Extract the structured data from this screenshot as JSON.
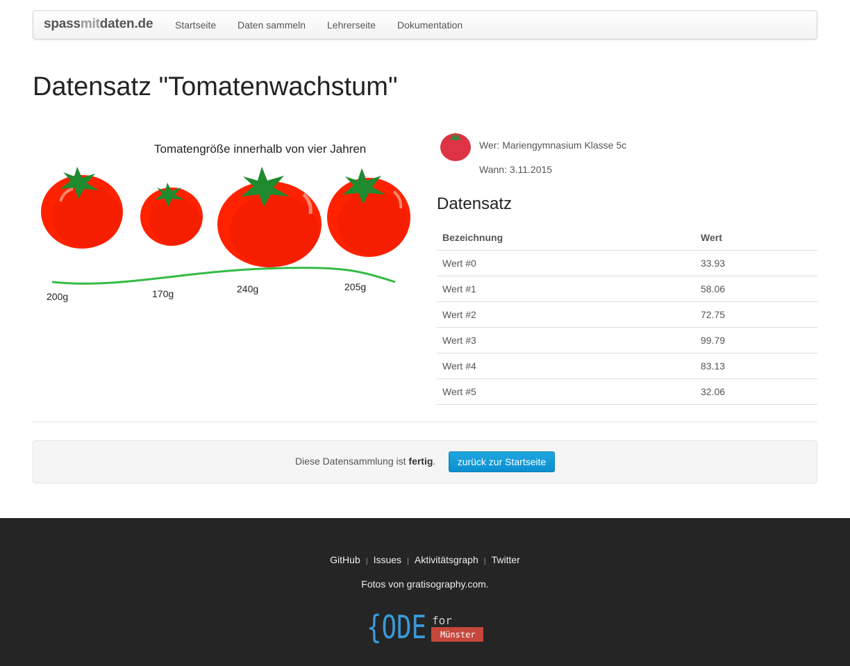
{
  "nav": {
    "brand_part1": "spass",
    "brand_part2": "mit",
    "brand_part3": "daten.de",
    "items": [
      "Startseite",
      "Daten sammeln",
      "Lehrerseite",
      "Dokumentation"
    ]
  },
  "page": {
    "title": "Datensatz \"Tomatenwachstum\""
  },
  "illustration": {
    "heading": "Tomatengröße innerhalb von vier Jahren",
    "weights": [
      "200g",
      "170g",
      "240g",
      "205g"
    ]
  },
  "meta": {
    "who": "Wer: Mariengymnasium Klasse 5c",
    "when": "Wann: 3.11.2015"
  },
  "dataset": {
    "heading": "Datensatz",
    "columns": [
      "Bezeichnung",
      "Wert"
    ],
    "rows": [
      {
        "label": "Wert #0",
        "value": "33.93"
      },
      {
        "label": "Wert #1",
        "value": "58.06"
      },
      {
        "label": "Wert #2",
        "value": "72.75"
      },
      {
        "label": "Wert #3",
        "value": "99.79"
      },
      {
        "label": "Wert #4",
        "value": "83.13"
      },
      {
        "label": "Wert #5",
        "value": "32.06"
      }
    ]
  },
  "status": {
    "text_before": "Diese Datensammlung ist ",
    "state": "fertig",
    "text_after": ".",
    "button": "zurück zur Startseite"
  },
  "footer": {
    "links": [
      "GitHub",
      "Issues",
      "Aktivitätsgraph",
      "Twitter"
    ],
    "credit": "Fotos von gratisography.com.",
    "logo_main": "{ODE",
    "logo_for": "for",
    "logo_city": "Münster"
  },
  "colors": {
    "tomato": "#ff2200",
    "leaf": "#1f8a2e",
    "button": "#0b8ed0",
    "footer_bg": "#252525",
    "logo_badge": "#c6473c"
  }
}
